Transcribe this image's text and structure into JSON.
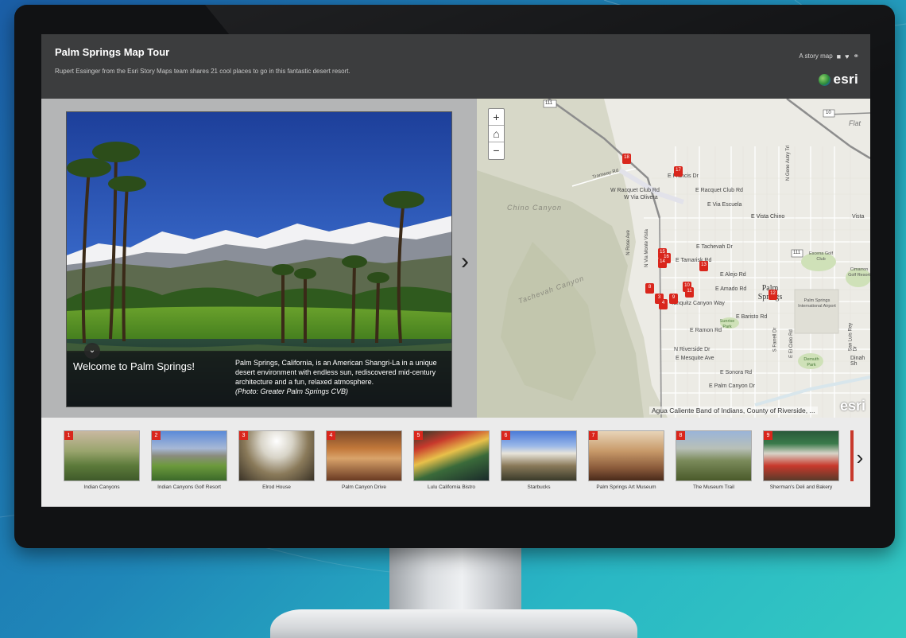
{
  "app": {
    "title": "Palm Springs Map Tour",
    "subtitle": "Rupert Essinger from the Esri Story Maps team shares 21 cool places to go in this fantastic desert resort.",
    "share_label": "A story map",
    "share_icons": [
      "facebook-icon",
      "twitter-icon",
      "link-icon"
    ],
    "brand": "esri"
  },
  "media": {
    "caption_title": "Welcome to Palm Springs!",
    "caption_text": "Palm Springs, California, is an American Shangri-La in a unique desert environment with endless sun, rediscovered mid-century architecture and a fun, relaxed atmosphere.",
    "caption_credit": "(Photo: Greater Palm Springs CVB)",
    "toggle_icon": "chevron-down-icon",
    "next_icon": "chevron-right-icon"
  },
  "map": {
    "zoom_in": "+",
    "home": "⌂",
    "zoom_out": "−",
    "attribution": "Agua Caliente Band of Indians, County of Riverside, ...",
    "logo": "esri",
    "labels": {
      "chino_canyon": "Chino Canyon",
      "tachevah_canyon": "Tachevah Canyon",
      "flat": "Flat",
      "vista": "Vista",
      "e_via_escuela": "E Via Escuela",
      "e_vista_chino": "E Vista Chino",
      "e_tachevah_dr": "E Tachevah Dr",
      "e_tamarisk_rd": "E Tamarisk Rd",
      "e_alejo_rd": "E Alejo Rd",
      "e_amado_rd": "E Amado Rd",
      "palm_springs": "Palm Springs",
      "e_baristo_rd": "E Baristo Rd",
      "e_ramon_rd": "E Ramon Rd",
      "n_riverside_dr": "N Riverside Dr",
      "e_mesquite_ave": "E Mesquite Ave",
      "e_sonora_rd": "E Sonora Rd",
      "e_palm_canyon_dr": "E Palm Canyon Dr",
      "w_racquet_club_rd": "W Racquet Club Rd",
      "w_via_olivera": "W Via Olivera",
      "e_racquet_club_rd": "E Racquet Club Rd",
      "e_francis_dr": "E Francis Dr",
      "tramway_rd": "Tramway Rd",
      "n_rose_ave": "N Rose Ave",
      "n_via_monte_vista": "N Via Monte Vista",
      "palm_springs_airport": "Palm Springs International Airport",
      "escena_golf_club": "Escena Golf Club",
      "cimarron_golf_resort": "Cimarron Golf Resort",
      "demuth_park": "Demuth Park",
      "sunrise_park": "Sunrise Park",
      "tahquitz_canyon_way": "Tahquitz Canyon Way",
      "e_el_cielo_rd": "E El Cielo Rd",
      "s_farrell_dr": "S Farrell Dr",
      "san_luis_rey_dr": "San Luis Rey Dr",
      "dinah_shore": "Dinah Sh",
      "gene_autry_trl": "N Gene Autry Trl",
      "route_111": "111",
      "route_111b": "111",
      "route_10": "10"
    },
    "markers": [
      {
        "n": "18"
      },
      {
        "n": "17"
      },
      {
        "n": "13"
      },
      {
        "n": "15"
      },
      {
        "n": "16"
      },
      {
        "n": "14"
      },
      {
        "n": "8"
      },
      {
        "n": "10"
      },
      {
        "n": "11"
      },
      {
        "n": "3"
      },
      {
        "n": "4"
      },
      {
        "n": "9"
      },
      {
        "n": "12"
      }
    ]
  },
  "carousel": {
    "next_icon": "chevron-right-icon",
    "items": [
      {
        "num": "1",
        "label": "Indian Canyons"
      },
      {
        "num": "2",
        "label": "Indian Canyons Golf Resort"
      },
      {
        "num": "3",
        "label": "Elrod House"
      },
      {
        "num": "4",
        "label": "Palm Canyon Drive"
      },
      {
        "num": "5",
        "label": "Lulu California Bistro"
      },
      {
        "num": "6",
        "label": "Starbucks"
      },
      {
        "num": "7",
        "label": "Palm Springs Art Museum"
      },
      {
        "num": "8",
        "label": "The Museum Trail"
      },
      {
        "num": "9",
        "label": "Sherman's Deli and Bakery"
      }
    ]
  },
  "colors": {
    "header_bg": "#3c3d3e",
    "marker_red": "#d9261c",
    "panel_gray": "#b4b5b6",
    "map_bg": "#ecebe5"
  }
}
